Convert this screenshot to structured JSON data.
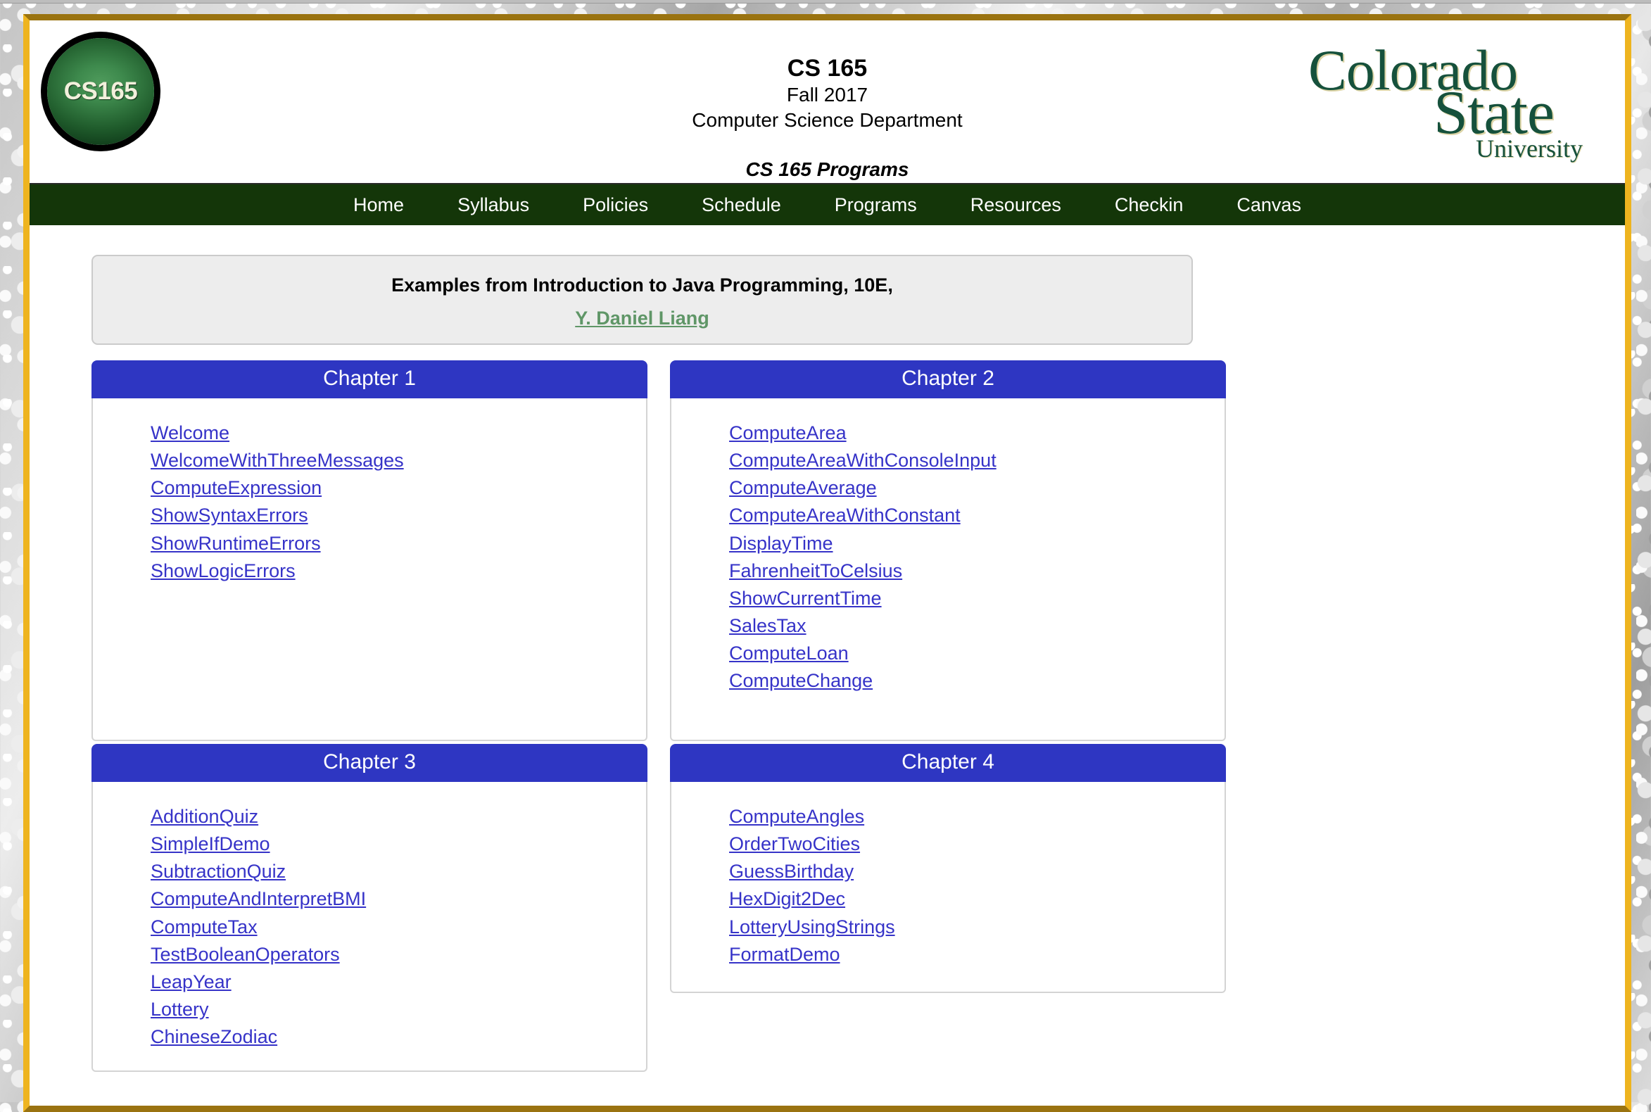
{
  "masthead": {
    "logo_badge_text": "CS165",
    "course_code": "CS 165",
    "term": "Fall 2017",
    "department": "Computer Science Department",
    "page_subtitle": "CS 165 Programs",
    "university_logo": {
      "line1": "Colorado",
      "line2": "State",
      "line3": "University"
    }
  },
  "nav": {
    "items": [
      {
        "label": "Home"
      },
      {
        "label": "Syllabus"
      },
      {
        "label": "Policies"
      },
      {
        "label": "Schedule"
      },
      {
        "label": "Programs"
      },
      {
        "label": "Resources"
      },
      {
        "label": "Checkin"
      },
      {
        "label": "Canvas"
      }
    ]
  },
  "info_box": {
    "title": "Examples from Introduction to Java Programming, 10E,",
    "author_link": "Y. Daniel Liang"
  },
  "chapters": [
    {
      "title": "Chapter 1",
      "programs": [
        "Welcome",
        "WelcomeWithThreeMessages",
        "ComputeExpression",
        "ShowSyntaxErrors",
        "ShowRuntimeErrors",
        "ShowLogicErrors"
      ]
    },
    {
      "title": "Chapter 2",
      "programs": [
        "ComputeArea",
        "ComputeAreaWithConsoleInput",
        "ComputeAverage",
        "ComputeAreaWithConstant",
        "DisplayTime",
        "FahrenheitToCelsius",
        "ShowCurrentTime",
        "SalesTax",
        "ComputeLoan",
        "ComputeChange"
      ]
    },
    {
      "title": "Chapter 3",
      "programs": [
        "AdditionQuiz",
        "SimpleIfDemo",
        "SubtractionQuiz",
        "ComputeAndInterpretBMI",
        "ComputeTax",
        "TestBooleanOperators",
        "LeapYear",
        "Lottery",
        "ChineseZodiac"
      ]
    },
    {
      "title": "Chapter 4",
      "programs": [
        "ComputeAngles",
        "OrderTwoCities",
        "GuessBirthday",
        "HexDigit2Dec",
        "LotteryUsingStrings",
        "FormatDemo"
      ]
    }
  ],
  "colors": {
    "nav_background": "#143609",
    "chapter_header": "#2e36c2",
    "link": "#3633c8",
    "author_link": "#5f9667",
    "frame_gold_light": "#eeb41f",
    "frame_gold_dark": "#9a7310",
    "csu_green": "#16513c",
    "info_box_background": "#ededed"
  }
}
